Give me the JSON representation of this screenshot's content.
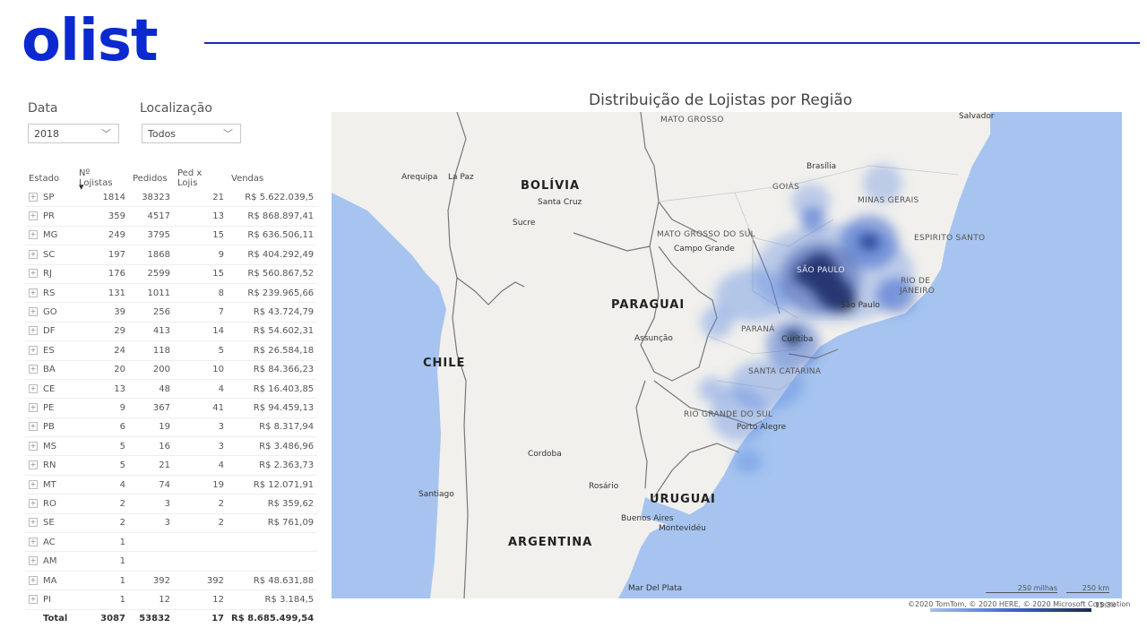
{
  "brand": {
    "logo_text": "olist"
  },
  "filters": {
    "data_label": "Data",
    "data_value": "2018",
    "localizacao_label": "Localização",
    "localizacao_value": "Todos"
  },
  "table": {
    "headers": [
      "Estado",
      "Nº Lojistas",
      "Pedidos",
      "Ped x Lojis",
      "Vendas"
    ],
    "rows": [
      [
        "SP",
        "1814",
        "38323",
        "21",
        "R$ 5.622.039,5"
      ],
      [
        "PR",
        "359",
        "4517",
        "13",
        "R$ 868.897,41"
      ],
      [
        "MG",
        "249",
        "3795",
        "15",
        "R$ 636.506,11"
      ],
      [
        "SC",
        "197",
        "1868",
        "9",
        "R$ 404.292,49"
      ],
      [
        "RJ",
        "176",
        "2599",
        "15",
        "R$ 560.867,52"
      ],
      [
        "RS",
        "131",
        "1011",
        "8",
        "R$ 239.965,66"
      ],
      [
        "GO",
        "39",
        "256",
        "7",
        "R$ 43.724,79"
      ],
      [
        "DF",
        "29",
        "413",
        "14",
        "R$ 54.602,31"
      ],
      [
        "ES",
        "24",
        "118",
        "5",
        "R$ 26.584,18"
      ],
      [
        "BA",
        "20",
        "200",
        "10",
        "R$ 84.366,23"
      ],
      [
        "CE",
        "13",
        "48",
        "4",
        "R$ 16.403,85"
      ],
      [
        "PE",
        "9",
        "367",
        "41",
        "R$ 94.459,13"
      ],
      [
        "PB",
        "6",
        "19",
        "3",
        "R$ 8.317,94"
      ],
      [
        "MS",
        "5",
        "16",
        "3",
        "R$ 3.486,96"
      ],
      [
        "RN",
        "5",
        "21",
        "4",
        "R$ 2.363,73"
      ],
      [
        "MT",
        "4",
        "74",
        "19",
        "R$ 12.071,91"
      ],
      [
        "RO",
        "2",
        "3",
        "2",
        "R$ 359,62"
      ],
      [
        "SE",
        "2",
        "3",
        "2",
        "R$ 761,09"
      ],
      [
        "AC",
        "1",
        "",
        "",
        ""
      ],
      [
        "AM",
        "1",
        "",
        "",
        ""
      ],
      [
        "MA",
        "1",
        "392",
        "392",
        "R$ 48.631,88"
      ],
      [
        "PI",
        "1",
        "12",
        "12",
        "R$ 3.184,5"
      ]
    ],
    "total": [
      "Total",
      "3087",
      "53832",
      "17",
      "R$ 8.685.499,54"
    ]
  },
  "map": {
    "title": "Distribuição de Lojistas por Região",
    "countries": [
      "BOLÍVIA",
      "PARAGUAI",
      "CHILE",
      "URUGUAI",
      "ARGENTINA"
    ],
    "states": [
      "MATO GROSSO",
      "GOIÁS",
      "MINAS GERAIS",
      "ESPIRITO SANTO",
      "MATO GROSSO DO SUL",
      "SÃO PAULO",
      "RIO DE",
      "JANEIRO",
      "PARANÁ",
      "SANTA CATARINA",
      "RIO GRANDE DO SUL"
    ],
    "cities": [
      "Salvador",
      "Brasília",
      "Arequipa",
      "La Paz",
      "Santa Cruz",
      "Sucre",
      "Campo Grande",
      "São Paulo",
      "Curitiba",
      "Assunção",
      "Porto Alegre",
      "Cordoba",
      "Rosário",
      "Santiago",
      "Buenos Aires",
      "Montevidéu",
      "Mar Del Plata"
    ],
    "scale": {
      "miles": "250 milhas",
      "km": "250 km"
    },
    "copyright": "©2020 TomTom, © 2020 HERE, © 2020 Microsoft Corporation",
    "legend_max": "15.3k",
    "colors": {
      "water": "#a6c4ef",
      "land": "#f2f1ee",
      "heat_low": "#5a86e0",
      "heat_high": "#1e2a4a"
    }
  }
}
